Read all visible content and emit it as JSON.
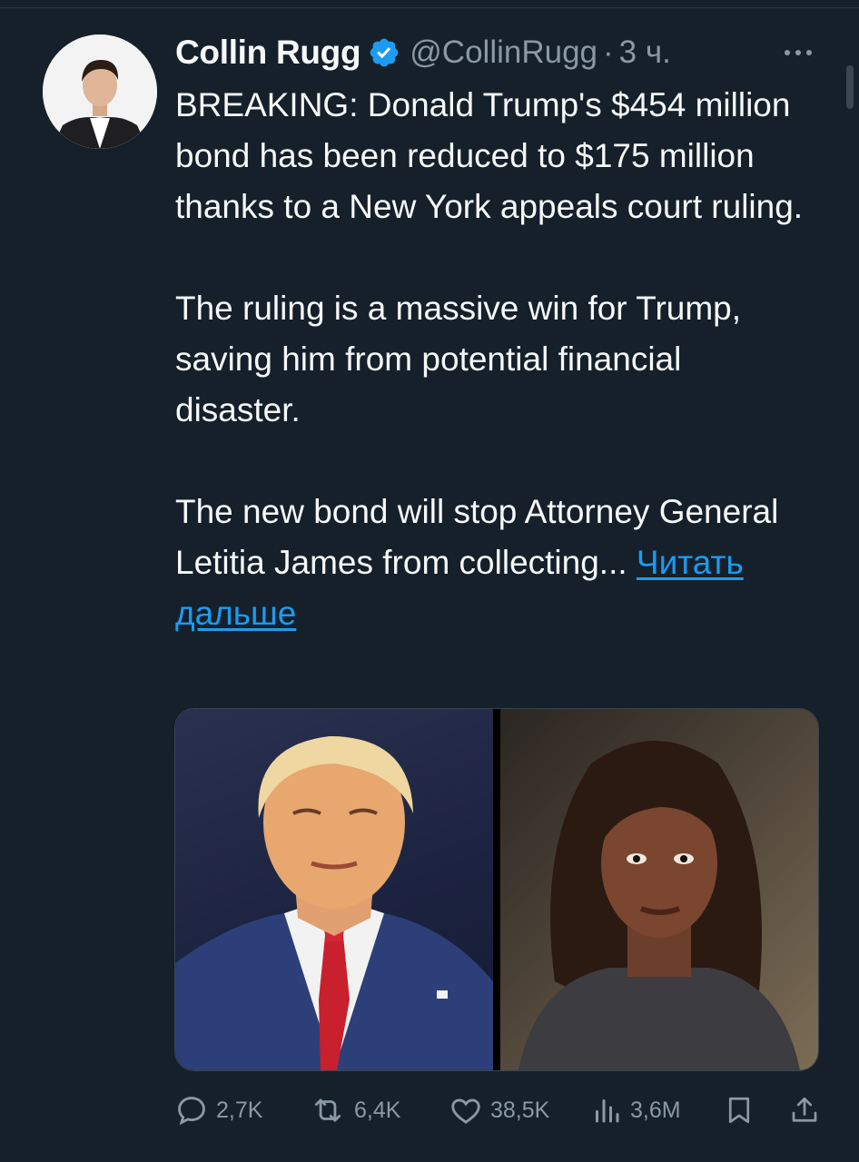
{
  "tweet": {
    "author_name": "Collin Rugg",
    "handle": "@CollinRugg",
    "separator": "·",
    "time": "3 ч.",
    "paragraph1": "BREAKING: Donald Trump's $454 million bond has been reduced to $175 million thanks to a New York appeals court ruling.",
    "paragraph2": "The ruling is a massive win for Trump, saving him from potential financial disaster.",
    "paragraph3": "The new bond will stop Attorney General Letitia James from collecting...",
    "read_more": "Читать дальше"
  },
  "media": {
    "images": [
      {
        "subject": "Donald Trump"
      },
      {
        "subject": "Letitia James"
      }
    ]
  },
  "actions": {
    "replies": "2,7K",
    "reposts": "6,4K",
    "likes": "38,5K",
    "views": "3,6M"
  },
  "icons": [
    "verified-badge-icon",
    "more-icon",
    "reply-icon",
    "repost-icon",
    "like-icon",
    "views-icon",
    "bookmark-icon",
    "share-icon"
  ],
  "colors": {
    "background": "#15202b",
    "text": "#f7f9f9",
    "secondary_text": "#8b98a5",
    "link": "#1d9bf0"
  }
}
